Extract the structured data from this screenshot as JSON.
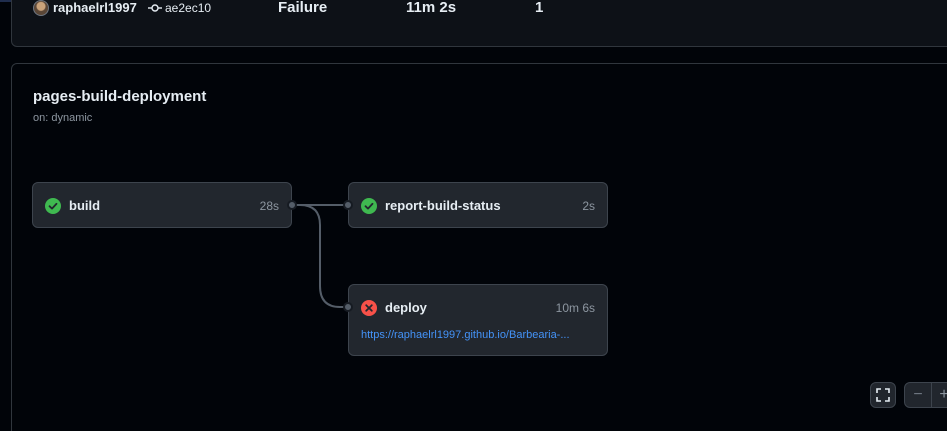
{
  "run_summary": {
    "actor": "raphaelrl1997",
    "commit_sha": "ae2ec10",
    "status": "Failure",
    "total_duration": "11m 2s",
    "artifacts": "1"
  },
  "workflow": {
    "title": "pages-build-deployment",
    "trigger": "on: dynamic",
    "jobs": [
      {
        "name": "build",
        "duration": "28s",
        "status": "success",
        "icon": "check-circle-icon"
      },
      {
        "name": "report-build-status",
        "duration": "2s",
        "status": "success",
        "icon": "check-circle-icon"
      },
      {
        "name": "deploy",
        "duration": "10m 6s",
        "status": "failure",
        "icon": "x-circle-icon",
        "link": "https://raphaelrl1997.github.io/Barbearia-..."
      }
    ]
  },
  "controls": {
    "zoom_out": "−",
    "zoom_in": "+",
    "fullscreen_icon": "fullscreen-icon"
  },
  "colors": {
    "success": "#3fb950",
    "failure": "#f85149",
    "link": "#4493f8",
    "background": "#010409",
    "job_card": "#22272e"
  }
}
